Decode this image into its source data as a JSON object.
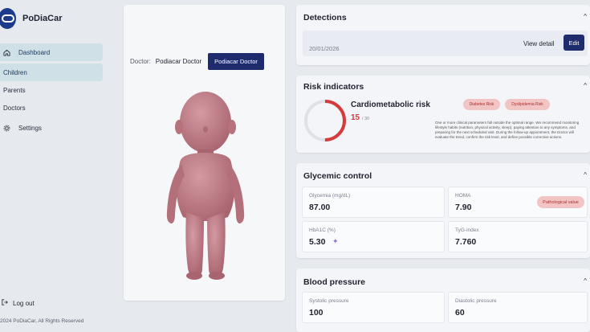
{
  "app": {
    "name": "PoDiaCar"
  },
  "sidebar": {
    "items": [
      {
        "label": "Dashboard",
        "icon": "home-icon",
        "active": true
      },
      {
        "label": "Children",
        "active": true
      },
      {
        "label": "Parents"
      },
      {
        "label": "Doctors"
      },
      {
        "label": "Settings",
        "icon": "gear-icon"
      }
    ],
    "logout_label": "Log out",
    "copyright": "2024 PoDiaCar, All Rights Reserved"
  },
  "doctor": {
    "label": "Doctor:",
    "name": "Podiacar Doctor",
    "button_label": "Podiacar Doctor"
  },
  "detections": {
    "title": "Detections",
    "date": "20/01/2026",
    "view_detail_label": "View detail",
    "edit_label": "Edit"
  },
  "risk": {
    "title": "Risk indicators",
    "name": "Cardiometabolic risk",
    "score": "15",
    "max": "/ 30",
    "score_fraction": 0.5,
    "tags": [
      "Diabetes Risk",
      "Dyslipidemia Risk"
    ],
    "description": "One or more clinical parameters fall outside the optimal range. We recommend monitoring lifestyle habits (nutrition, physical activity, sleep), paying attention to any symptoms, and preparing for the next scheduled visit. During the follow-up appointment, the Doctor will evaluate the trend, confirm the risk level, and define possible corrective actions."
  },
  "glycemic": {
    "title": "Glycemic control",
    "metrics": [
      {
        "label": "Glycemia (mg/dL)",
        "value": "87.00"
      },
      {
        "label": "HOMA",
        "value": "7.90"
      },
      {
        "label": "HbA1C (%)",
        "value": "5.30"
      },
      {
        "label": "TyG-index",
        "value": "7.760"
      }
    ],
    "flag": "Pathological value"
  },
  "blood_pressure": {
    "title": "Blood pressure",
    "metrics": [
      {
        "label": "Systolic pressure",
        "value": "100"
      },
      {
        "label": "Diastolic pressure",
        "value": "60"
      }
    ]
  },
  "colors": {
    "primary": "#1e2c6e",
    "accent_red": "#d63b3b",
    "tag_bg": "#f3c4c4"
  }
}
